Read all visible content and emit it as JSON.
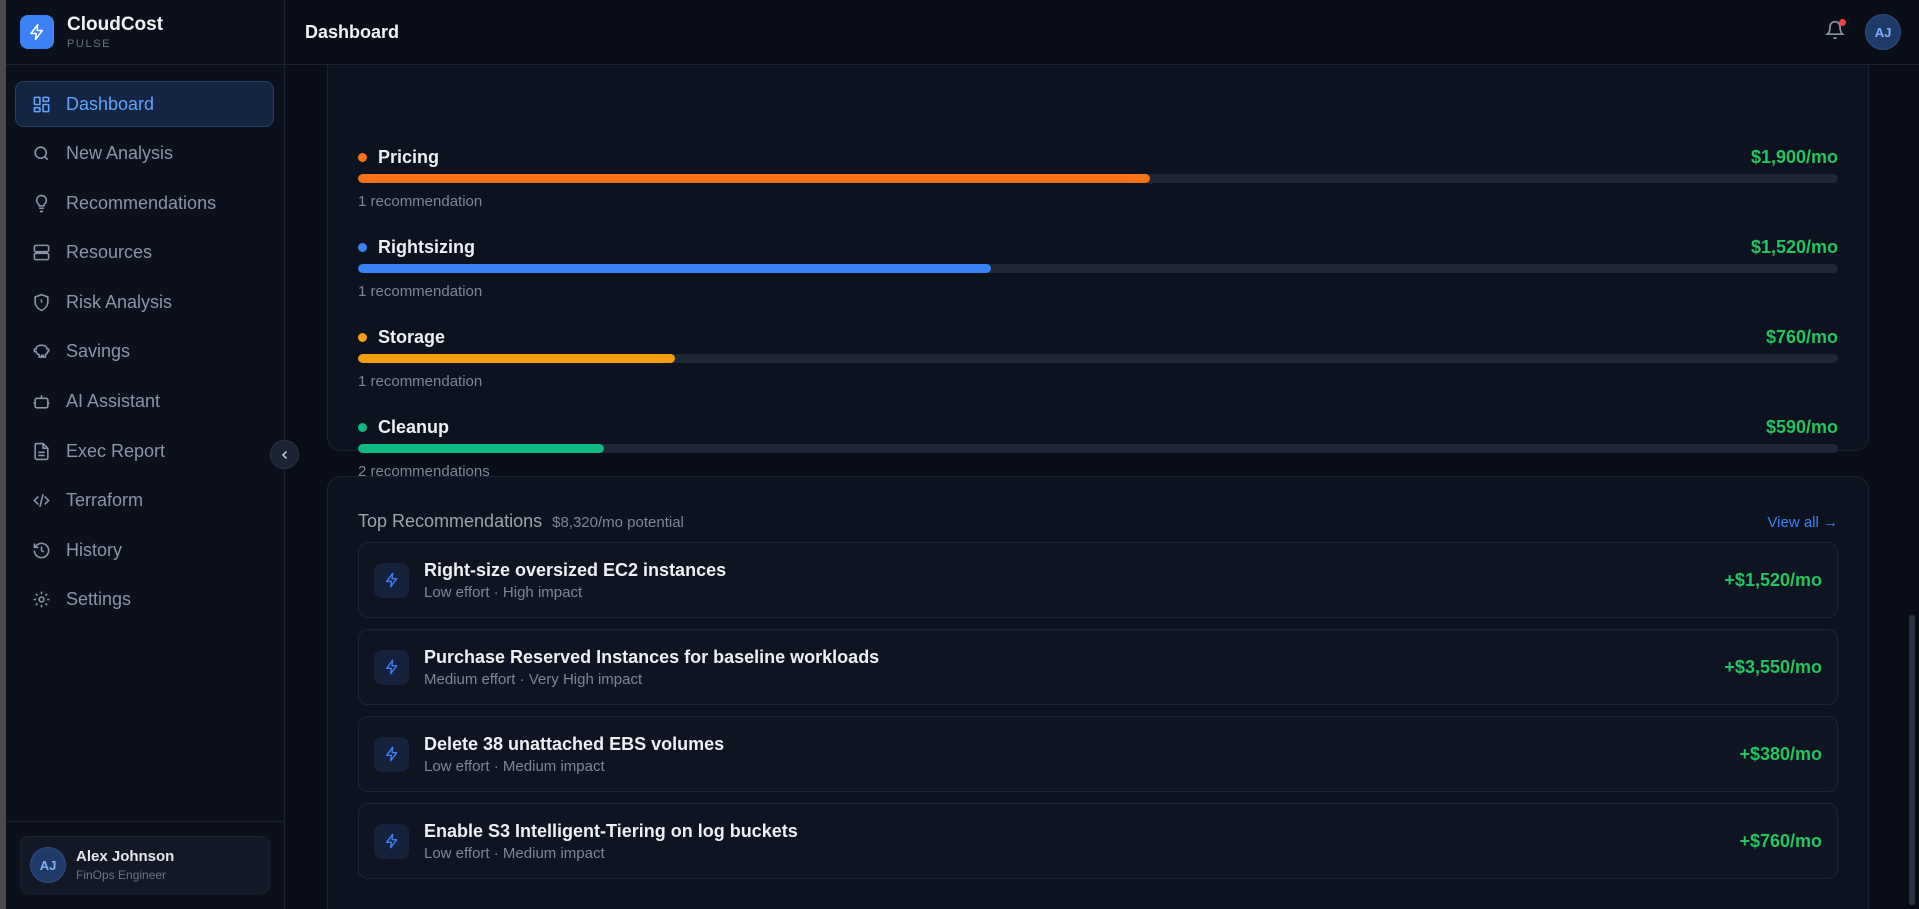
{
  "brand": {
    "name": "CloudCost",
    "subtitle": "PULSE"
  },
  "nav": [
    {
      "label": "Dashboard",
      "icon": "dashboard-icon",
      "active": true
    },
    {
      "label": "New Analysis",
      "icon": "search-icon"
    },
    {
      "label": "Recommendations",
      "icon": "lightbulb-icon"
    },
    {
      "label": "Resources",
      "icon": "server-icon"
    },
    {
      "label": "Risk Analysis",
      "icon": "shield-icon"
    },
    {
      "label": "Savings",
      "icon": "piggy-bank-icon"
    },
    {
      "label": "AI Assistant",
      "icon": "robot-icon"
    },
    {
      "label": "Exec Report",
      "icon": "document-icon"
    },
    {
      "label": "Terraform",
      "icon": "code-icon"
    },
    {
      "label": "History",
      "icon": "history-icon"
    },
    {
      "label": "Settings",
      "icon": "gear-icon"
    }
  ],
  "user": {
    "initials": "AJ",
    "name": "Alex Johnson",
    "role": "FinOps Engineer"
  },
  "header": {
    "title": "Dashboard",
    "avatar_initials": "AJ",
    "has_notification": true
  },
  "categories": [
    {
      "name": "Pricing",
      "amount": "$1,900/mo",
      "count": "1 recommendation",
      "color": "#f97316",
      "fill": 0.535
    },
    {
      "name": "Rightsizing",
      "amount": "$1,520/mo",
      "count": "1 recommendation",
      "color": "#3b82f6",
      "fill": 0.428
    },
    {
      "name": "Storage",
      "amount": "$760/mo",
      "count": "1 recommendation",
      "color": "#f59e0b",
      "fill": 0.214
    },
    {
      "name": "Cleanup",
      "amount": "$590/mo",
      "count": "2 recommendations",
      "color": "#10b981",
      "fill": 0.166
    }
  ],
  "recommendations": {
    "title": "Top Recommendations",
    "potential": "$8,320/mo potential",
    "view_all": "View all →",
    "items": [
      {
        "title": "Right-size oversized EC2 instances",
        "meta": "Low effort · High impact",
        "amount": "+$1,520/mo"
      },
      {
        "title": "Purchase Reserved Instances for baseline workloads",
        "meta": "Medium effort · Very High impact",
        "amount": "+$3,550/mo"
      },
      {
        "title": "Delete 38 unattached EBS volumes",
        "meta": "Low effort · Medium impact",
        "amount": "+$380/mo"
      },
      {
        "title": "Enable S3 Intelligent-Tiering on log buckets",
        "meta": "Low effort · Medium impact",
        "amount": "+$760/mo"
      }
    ]
  },
  "colors": {
    "accent": "#3b82f6",
    "savings": "#22c55e",
    "background": "#090d17"
  }
}
